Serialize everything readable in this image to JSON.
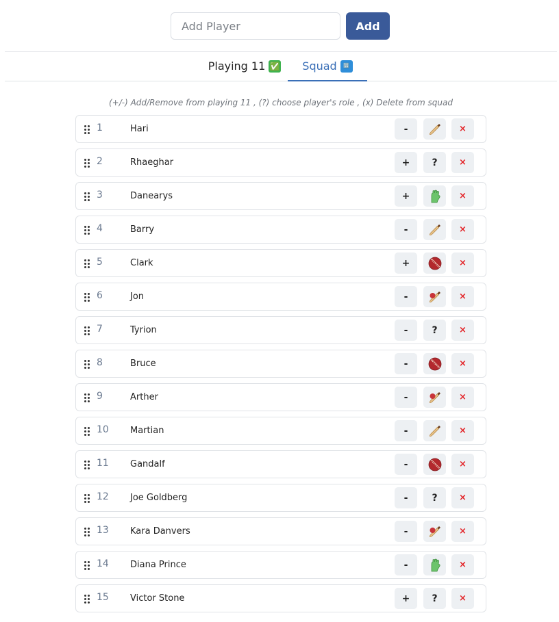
{
  "add_player": {
    "placeholder": "Add Player",
    "button_label": "Add"
  },
  "tabs": [
    {
      "label": "Playing 11",
      "emoji": "✅"
    },
    {
      "label": "Squad",
      "emoji": "🔢"
    }
  ],
  "hint": "(+/-) Add/Remove from playing 11 , (?) choose player's role , (x) Delete from squad",
  "players": [
    {
      "index": "1",
      "name": "Hari",
      "toggle": "-",
      "role": "bat"
    },
    {
      "index": "2",
      "name": "Rhaeghar",
      "toggle": "+",
      "role": "unknown"
    },
    {
      "index": "3",
      "name": "Danearys",
      "toggle": "+",
      "role": "gloves"
    },
    {
      "index": "4",
      "name": "Barry",
      "toggle": "-",
      "role": "bat"
    },
    {
      "index": "5",
      "name": "Clark",
      "toggle": "+",
      "role": "ball"
    },
    {
      "index": "6",
      "name": "Jon",
      "toggle": "-",
      "role": "allrounder"
    },
    {
      "index": "7",
      "name": "Tyrion",
      "toggle": "-",
      "role": "unknown"
    },
    {
      "index": "8",
      "name": "Bruce",
      "toggle": "-",
      "role": "ball"
    },
    {
      "index": "9",
      "name": "Arther",
      "toggle": "-",
      "role": "allrounder"
    },
    {
      "index": "10",
      "name": "Martian",
      "toggle": "-",
      "role": "bat"
    },
    {
      "index": "11",
      "name": "Gandalf",
      "toggle": "-",
      "role": "ball"
    },
    {
      "index": "12",
      "name": "Joe Goldberg",
      "toggle": "-",
      "role": "unknown"
    },
    {
      "index": "13",
      "name": "Kara Danvers",
      "toggle": "-",
      "role": "allrounder"
    },
    {
      "index": "14",
      "name": "Diana Prince",
      "toggle": "-",
      "role": "gloves"
    },
    {
      "index": "15",
      "name": "Victor Stone",
      "toggle": "+",
      "role": "unknown"
    }
  ],
  "delete_symbol": "×",
  "unknown_role_symbol": "?",
  "colors": {
    "accent": "#3a5a99",
    "tab_active": "#3a6fb7",
    "delete": "#e3262a"
  }
}
